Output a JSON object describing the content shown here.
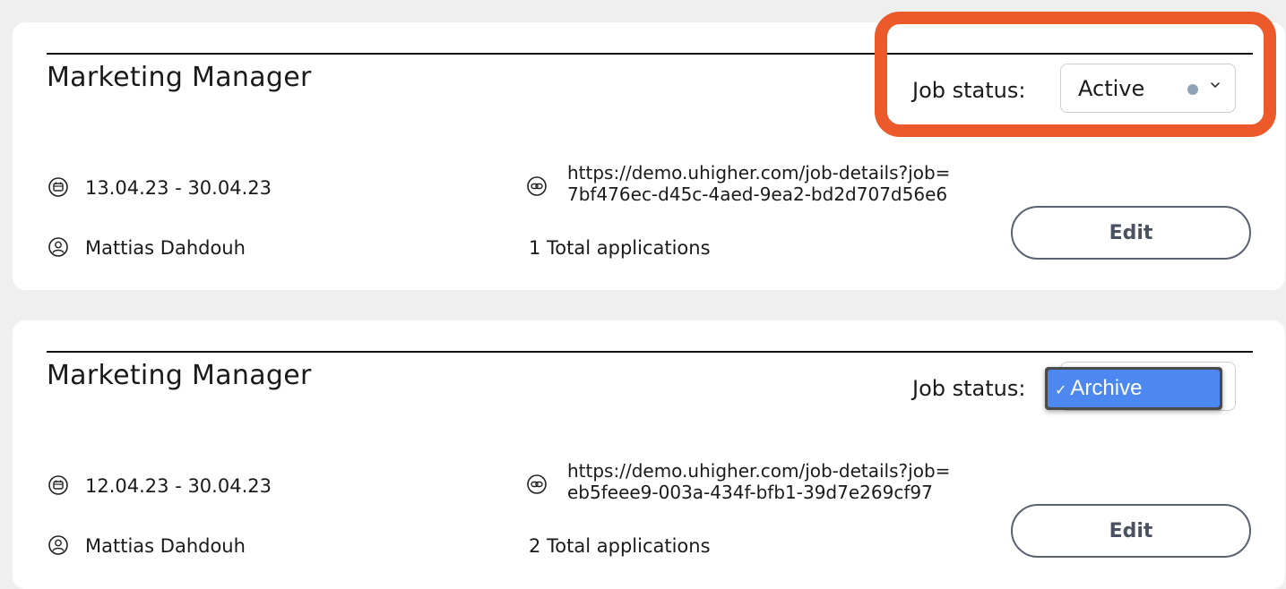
{
  "job_status_label": "Job status:",
  "edit_label": "Edit",
  "jobs": [
    {
      "title": "Marketing Manager",
      "date_range": "13.04.23 - 30.04.23",
      "owner": "Mattias Dahdouh",
      "link_line1": "https://demo.uhigher.com/job-details?job=",
      "link_line2": "7bf476ec-d45c-4aed-9ea2-bd2d707d56e6",
      "applications": "1 Total applications",
      "status": "Active"
    },
    {
      "title": "Marketing Manager",
      "date_range": "12.04.23 - 30.04.23",
      "owner": "Mattias Dahdouh",
      "link_line1": "https://demo.uhigher.com/job-details?job=",
      "link_line2": "eb5feee9-003a-434f-bfb1-39d7e269cf97",
      "applications": "2 Total applications",
      "status": "Archive"
    }
  ],
  "dropdown": {
    "check": "✓",
    "selected_option": "Archive"
  },
  "colors": {
    "highlight": "#ec5a2c",
    "status_dot": "#8fa3b5",
    "dropdown_selected": "#4c88f0"
  },
  "icons": {
    "date": "calendar-icon",
    "owner": "user-icon",
    "link": "link-icon",
    "select": "chevron-down-icon"
  }
}
